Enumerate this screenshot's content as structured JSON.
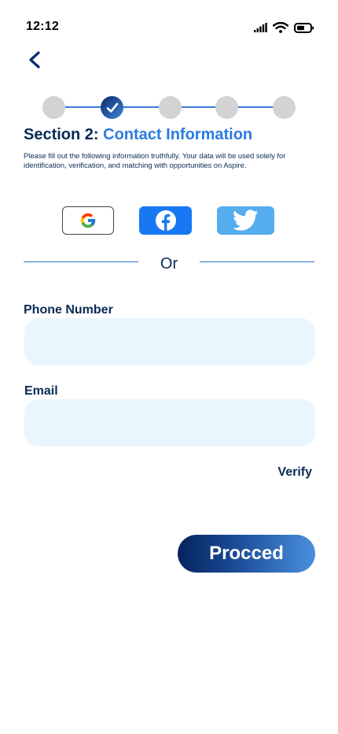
{
  "status_bar": {
    "time": "12:12",
    "icons": [
      "signal-icon",
      "wifi-icon",
      "battery-icon"
    ]
  },
  "navigation": {
    "back_icon": "chevron-left-icon"
  },
  "stepper": {
    "total_steps": 5,
    "completed_steps": [
      2
    ],
    "completed_icon": "checkmark-icon"
  },
  "section": {
    "number_label": "Section 2:",
    "name": "Contact Information",
    "description": "Please fill out the following information truthfully. Your data will be used solely for identification, verification, and matching with opportunities on Aspire."
  },
  "social_login": {
    "providers": [
      {
        "name": "google",
        "icon": "google-icon"
      },
      {
        "name": "facebook",
        "icon": "facebook-icon",
        "color": "#1877f2"
      },
      {
        "name": "twitter",
        "icon": "twitter-icon",
        "color": "#55acee"
      }
    ]
  },
  "divider": {
    "label": "Or"
  },
  "form": {
    "phone": {
      "label": "Phone Number",
      "value": "",
      "placeholder": ""
    },
    "email": {
      "label": "Email",
      "value": "",
      "placeholder": ""
    },
    "verify_label": "Verify"
  },
  "actions": {
    "proceed_label": "Procced"
  },
  "colors": {
    "primary_dark": "#0b2a55",
    "accent_blue": "#2b7be0",
    "input_bg": "#eaf6fe",
    "step_inactive": "#d3d3d3"
  }
}
